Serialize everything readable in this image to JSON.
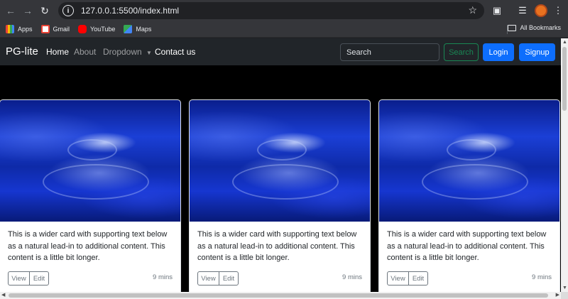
{
  "browser": {
    "url": "127.0.0.1:5500/index.html",
    "icons": {
      "back": "arrow-left-icon",
      "forward": "arrow-right-icon",
      "reload": "reload-icon",
      "site_info": "info-icon",
      "bookmark_star": "star-icon",
      "extensions": "puzzle-icon",
      "media": "media-controls-icon",
      "menu": "kebab-menu-icon"
    },
    "bookmarks": [
      {
        "label": "Apps",
        "icon": "apps-grid-icon",
        "color": "#ea4335"
      },
      {
        "label": "Gmail",
        "icon": "gmail-icon",
        "color": "#ea4335"
      },
      {
        "label": "YouTube",
        "icon": "youtube-icon",
        "color": "#ff0000"
      },
      {
        "label": "Maps",
        "icon": "maps-icon",
        "color": "#34a853"
      }
    ],
    "all_bookmarks": "All Bookmarks"
  },
  "navbar": {
    "brand": "PG-lite",
    "links": [
      {
        "label": "Home",
        "active": true
      },
      {
        "label": "About",
        "active": false
      },
      {
        "label": "Dropdown",
        "active": false
      },
      {
        "label": "Contact us",
        "active": true
      }
    ],
    "dropdown_caret": "caret-down-icon",
    "search_placeholder": "Search",
    "search_button": "Search",
    "login_button": "Login",
    "signup_button": "Signup",
    "colors": {
      "primary": "#0d6efd",
      "success": "#198754",
      "navbar_bg": "#212529"
    }
  },
  "cards": [
    {
      "text": "This is a wider card with supporting text below as a natural lead-in to additional content. This content is a little bit longer.",
      "view": "View",
      "edit": "Edit",
      "time": "9 mins"
    },
    {
      "text": "This is a wider card with supporting text below as a natural lead-in to additional content. This content is a little bit longer.",
      "view": "View",
      "edit": "Edit",
      "time": "9 mins"
    },
    {
      "text": "This is a wider card with supporting text below as a natural lead-in to additional content. This content is a little bit longer.",
      "view": "View",
      "edit": "Edit",
      "time": "9 mins"
    }
  ]
}
